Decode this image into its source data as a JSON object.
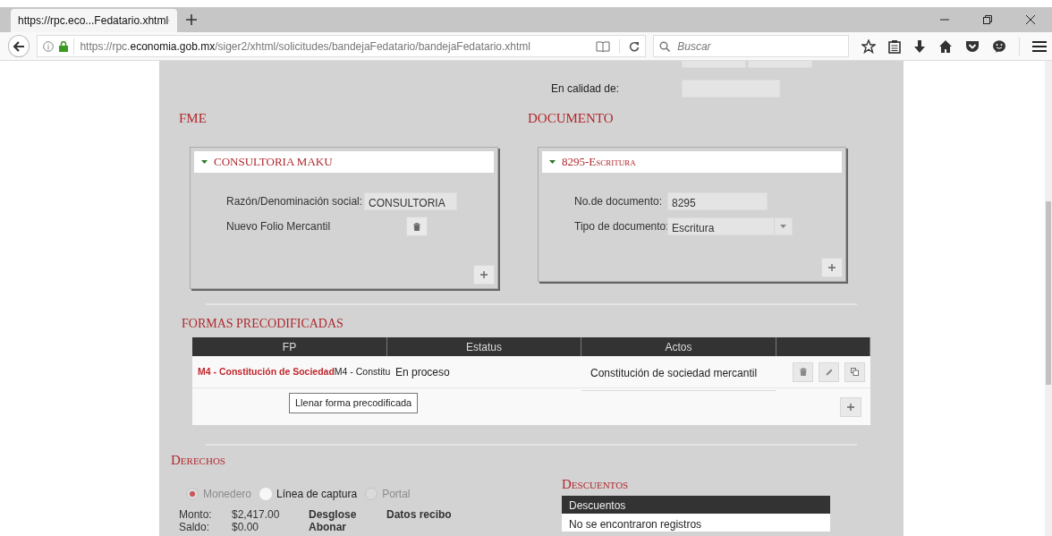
{
  "browser": {
    "tab_title": "https://rpc.eco...Fedatario.xhtml",
    "url_start": "https://rpc.",
    "url_domain": "economia.gob.mx",
    "url_path": "/siger2/xhtml/solicitudes/bandejaFedatario/bandejaFedatario.xhtml",
    "search_placeholder": "Buscar"
  },
  "representative": {
    "label": "En calidad de:"
  },
  "fme": {
    "heading": "FME",
    "panel": {
      "title": "CONSULTORIA MAKU",
      "expanded": true,
      "fields": [
        {
          "kind": "text",
          "label": "Razón/Denominación social:",
          "value": "CONSULTORIA"
        },
        {
          "kind": "delete",
          "label": "Nuevo Folio Mercantil"
        }
      ]
    }
  },
  "documento": {
    "heading": "DOCUMENTO",
    "panel": {
      "title": "8295-Escritura",
      "expanded": true,
      "fields": [
        {
          "kind": "text",
          "label": "No.de documento:",
          "value": "8295"
        },
        {
          "kind": "select",
          "label": "Tipo de documento:",
          "value": "Escritura"
        }
      ]
    }
  },
  "formas": {
    "heading": "FORMAS PRECODIFICADAS",
    "columns": [
      "FP",
      "Estatus",
      "Actos"
    ],
    "rows": [
      {
        "fp_link": "M4 - Constitución de Sociedad",
        "fp_text": "M4 - Constitu",
        "estatus": "En proceso",
        "actos": "Constitución de sociedad mercantil"
      }
    ],
    "tooltip": "Llenar forma precodificada"
  },
  "derechos": {
    "heading": "Derechos",
    "radios": [
      {
        "label": "Monedero",
        "selected": true,
        "disabled": true
      },
      {
        "label": "Línea de captura",
        "selected": false,
        "disabled": false
      },
      {
        "label": "Portal",
        "selected": false,
        "disabled": true
      }
    ],
    "amounts": [
      {
        "label": "Monto:",
        "value": "$2,417.00",
        "action": "Desglose",
        "extra": "Datos recibo"
      },
      {
        "label": "Saldo:",
        "value": "$0.00",
        "action": "Abonar"
      }
    ]
  },
  "descuentos": {
    "heading": "Descuentos",
    "column": "Descuentos",
    "empty_text": "No se encontraron registros"
  }
}
